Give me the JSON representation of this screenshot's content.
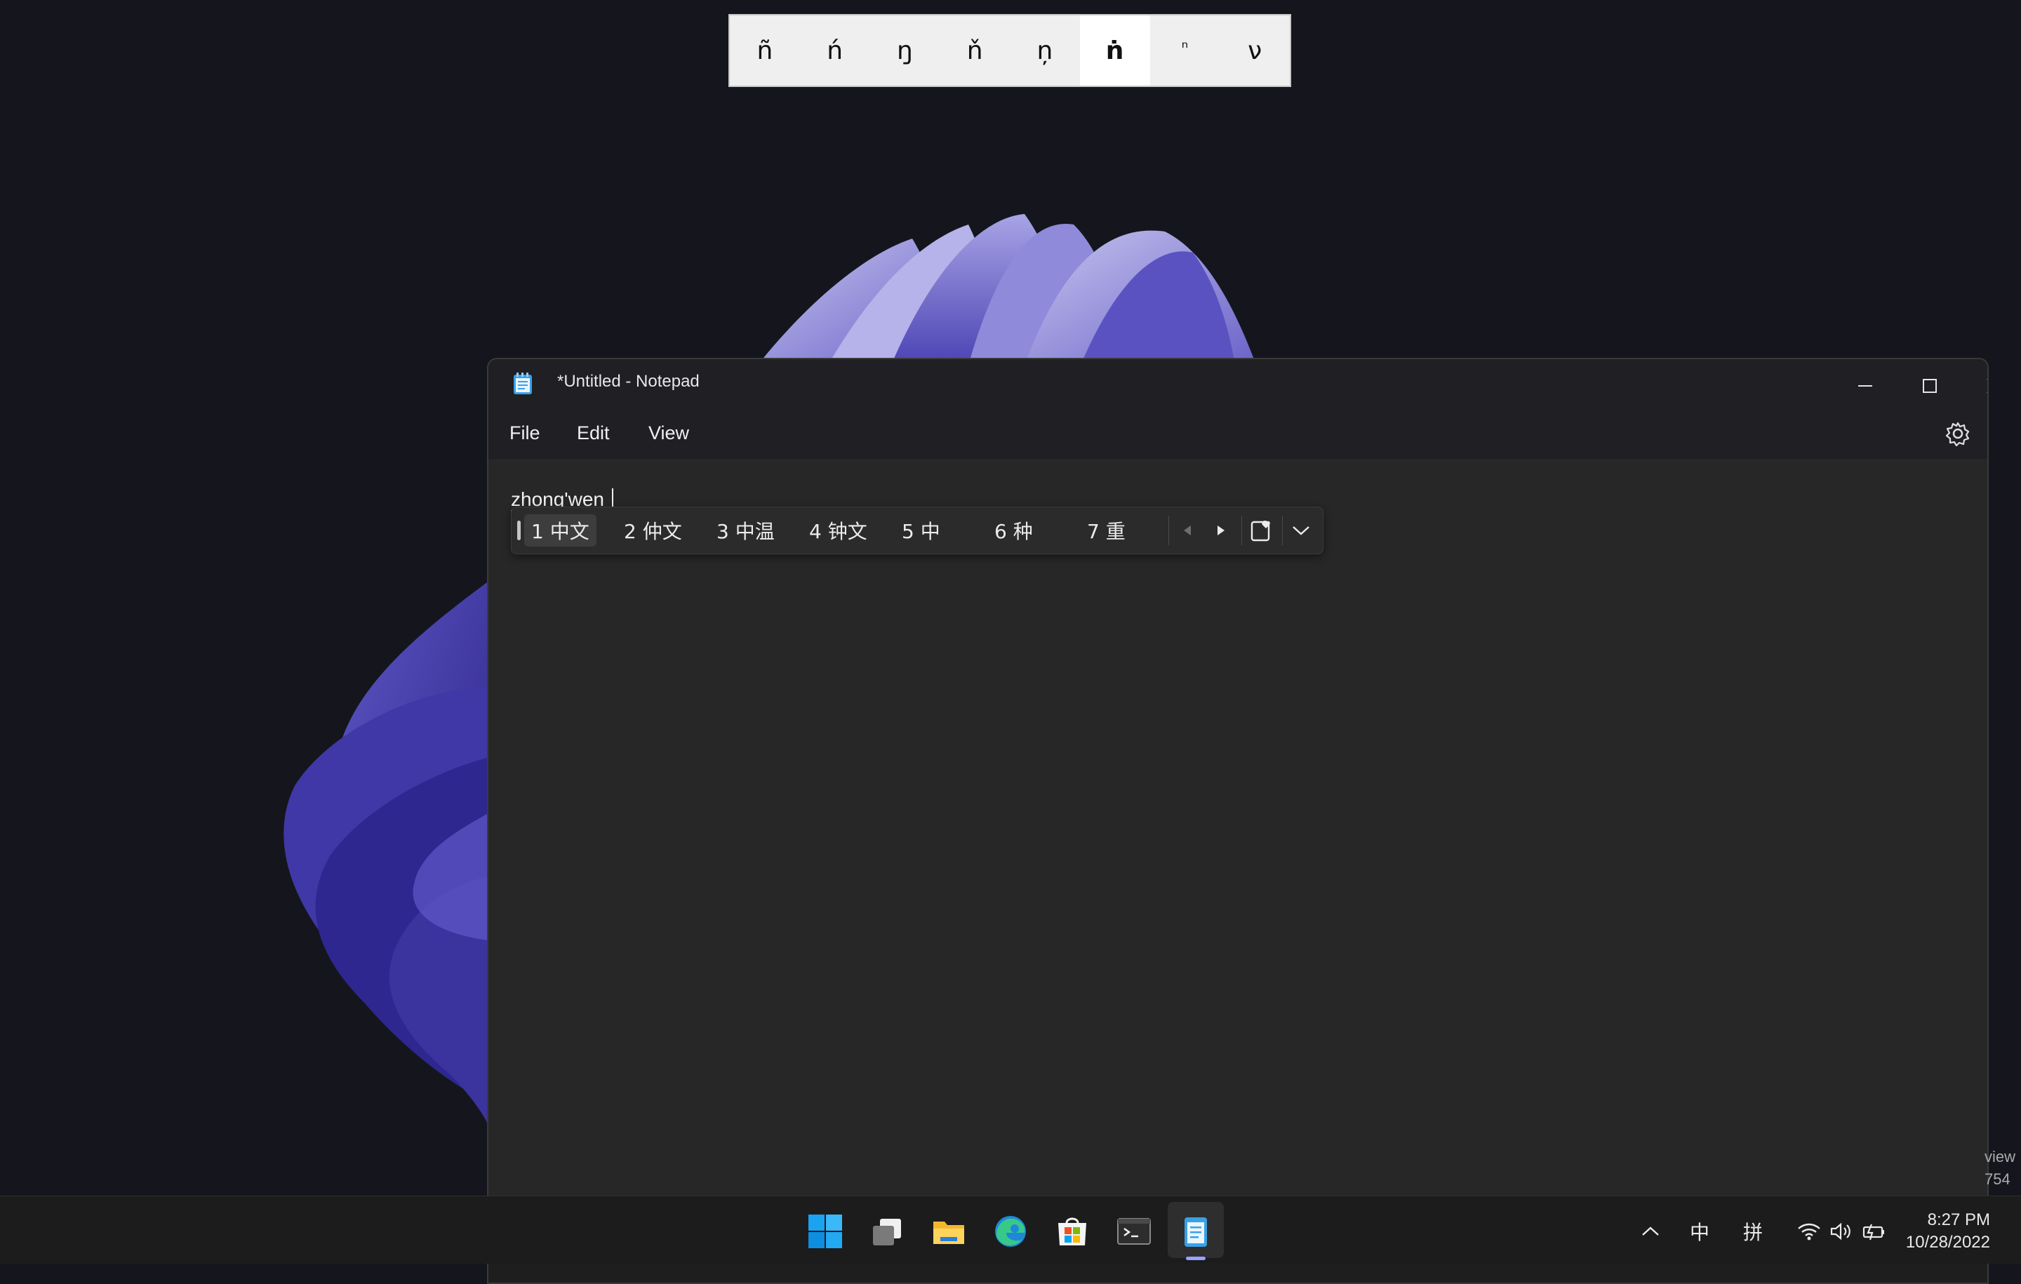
{
  "accent_picker": {
    "characters": [
      "ñ",
      "ń",
      "ŋ",
      "ň",
      "ņ",
      "ṅ",
      "ⁿ",
      "ν"
    ],
    "selected_index": 5
  },
  "notepad": {
    "title": "*Untitled - Notepad",
    "menu": {
      "file": "File",
      "edit": "Edit",
      "view": "View"
    },
    "typed_text": "zhong'wen"
  },
  "ime": {
    "candidates": [
      {
        "num": "1",
        "text": "中文"
      },
      {
        "num": "2",
        "text": "仲文"
      },
      {
        "num": "3",
        "text": "中温"
      },
      {
        "num": "4",
        "text": "钟文"
      },
      {
        "num": "5",
        "text": "中"
      },
      {
        "num": "6",
        "text": "种"
      },
      {
        "num": "7",
        "text": "重"
      }
    ],
    "selected_index": 0,
    "labels": [
      "1 中文",
      "2 仲文",
      "3 中温",
      "4 钟文",
      "5 中",
      "6 种",
      "7 重"
    ]
  },
  "tray": {
    "input_mode": "中",
    "input_method": "拼",
    "time": "8:27 PM",
    "date": "10/28/2022"
  },
  "edge_overlay": {
    "line1": "view",
    "line2": "754"
  },
  "taskbar_apps": [
    "start-icon",
    "task-view-icon",
    "file-explorer-icon",
    "edge-browser-icon",
    "store-icon",
    "terminal-icon",
    "notepad-icon"
  ],
  "colors": {
    "desktop": "#15161d",
    "accent": "#9aa2ff",
    "window": "#272727"
  }
}
